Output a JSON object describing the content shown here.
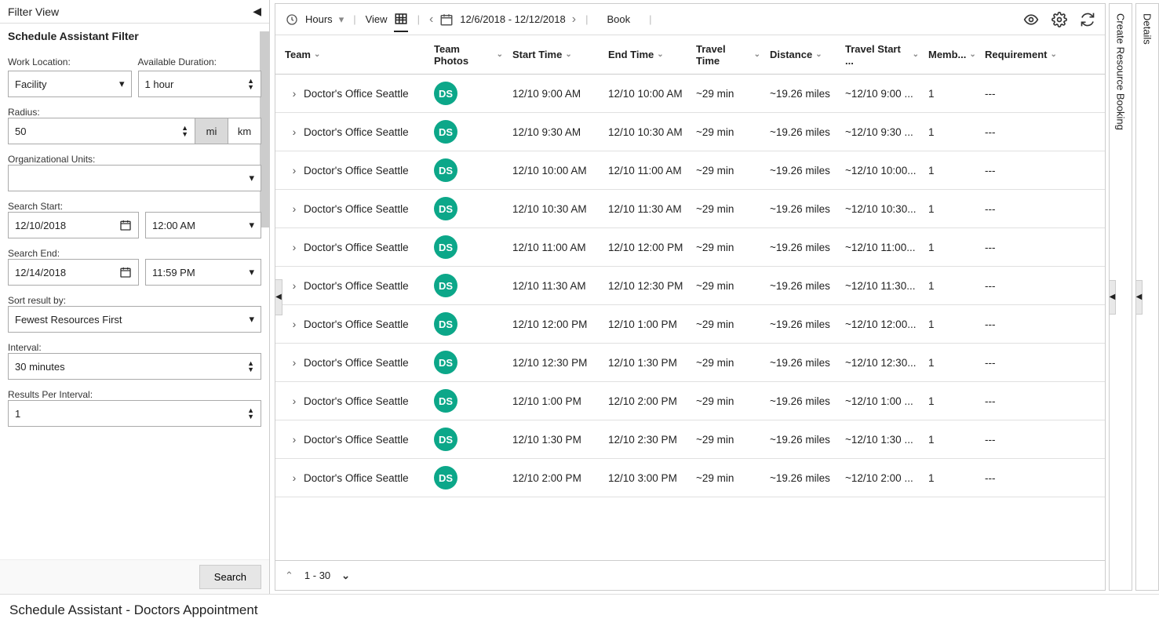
{
  "footer_title": "Schedule Assistant - Doctors Appointment",
  "left": {
    "header": "Filter View",
    "subheader": "Schedule Assistant Filter",
    "labels": {
      "work_location": "Work Location:",
      "available_duration": "Available Duration:",
      "radius": "Radius:",
      "org_units": "Organizational Units:",
      "search_start": "Search Start:",
      "search_end": "Search End:",
      "sort_result": "Sort result by:",
      "interval": "Interval:",
      "results_per_interval": "Results Per Interval:"
    },
    "values": {
      "work_location": "Facility",
      "available_duration": "1 hour",
      "radius": "50",
      "radius_unit_mi": "mi",
      "radius_unit_km": "km",
      "org_units": "",
      "search_start_date": "12/10/2018",
      "search_start_time": "12:00 AM",
      "search_end_date": "12/14/2018",
      "search_end_time": "11:59 PM",
      "sort_result": "Fewest Resources First",
      "interval": "30 minutes",
      "results_per_interval": "1"
    },
    "search_button": "Search"
  },
  "toolbar": {
    "hours_label": "Hours",
    "view_label": "View",
    "date_range": "12/6/2018 - 12/12/2018",
    "book_label": "Book"
  },
  "columns": {
    "team": "Team",
    "photos": "Team Photos",
    "start": "Start Time",
    "end": "End Time",
    "travel": "Travel Time",
    "distance": "Distance",
    "travel_start": "Travel Start ...",
    "members": "Memb...",
    "requirement": "Requirement"
  },
  "rows": [
    {
      "team": "Doctor's Office Seattle",
      "avatar": "DS",
      "start": "12/10 9:00 AM",
      "end": "12/10 10:00 AM",
      "travel": "~29 min",
      "distance": "~19.26 miles",
      "tstart": "~12/10 9:00 ...",
      "members": "1",
      "req": "---"
    },
    {
      "team": "Doctor's Office Seattle",
      "avatar": "DS",
      "start": "12/10 9:30 AM",
      "end": "12/10 10:30 AM",
      "travel": "~29 min",
      "distance": "~19.26 miles",
      "tstart": "~12/10 9:30 ...",
      "members": "1",
      "req": "---"
    },
    {
      "team": "Doctor's Office Seattle",
      "avatar": "DS",
      "start": "12/10 10:00 AM",
      "end": "12/10 11:00 AM",
      "travel": "~29 min",
      "distance": "~19.26 miles",
      "tstart": "~12/10 10:00...",
      "members": "1",
      "req": "---"
    },
    {
      "team": "Doctor's Office Seattle",
      "avatar": "DS",
      "start": "12/10 10:30 AM",
      "end": "12/10 11:30 AM",
      "travel": "~29 min",
      "distance": "~19.26 miles",
      "tstart": "~12/10 10:30...",
      "members": "1",
      "req": "---"
    },
    {
      "team": "Doctor's Office Seattle",
      "avatar": "DS",
      "start": "12/10 11:00 AM",
      "end": "12/10 12:00 PM",
      "travel": "~29 min",
      "distance": "~19.26 miles",
      "tstart": "~12/10 11:00...",
      "members": "1",
      "req": "---"
    },
    {
      "team": "Doctor's Office Seattle",
      "avatar": "DS",
      "start": "12/10 11:30 AM",
      "end": "12/10 12:30 PM",
      "travel": "~29 min",
      "distance": "~19.26 miles",
      "tstart": "~12/10 11:30...",
      "members": "1",
      "req": "---"
    },
    {
      "team": "Doctor's Office Seattle",
      "avatar": "DS",
      "start": "12/10 12:00 PM",
      "end": "12/10 1:00 PM",
      "travel": "~29 min",
      "distance": "~19.26 miles",
      "tstart": "~12/10 12:00...",
      "members": "1",
      "req": "---"
    },
    {
      "team": "Doctor's Office Seattle",
      "avatar": "DS",
      "start": "12/10 12:30 PM",
      "end": "12/10 1:30 PM",
      "travel": "~29 min",
      "distance": "~19.26 miles",
      "tstart": "~12/10 12:30...",
      "members": "1",
      "req": "---"
    },
    {
      "team": "Doctor's Office Seattle",
      "avatar": "DS",
      "start": "12/10 1:00 PM",
      "end": "12/10 2:00 PM",
      "travel": "~29 min",
      "distance": "~19.26 miles",
      "tstart": "~12/10 1:00 ...",
      "members": "1",
      "req": "---"
    },
    {
      "team": "Doctor's Office Seattle",
      "avatar": "DS",
      "start": "12/10 1:30 PM",
      "end": "12/10 2:30 PM",
      "travel": "~29 min",
      "distance": "~19.26 miles",
      "tstart": "~12/10 1:30 ...",
      "members": "1",
      "req": "---"
    },
    {
      "team": "Doctor's Office Seattle",
      "avatar": "DS",
      "start": "12/10 2:00 PM",
      "end": "12/10 3:00 PM",
      "travel": "~29 min",
      "distance": "~19.26 miles",
      "tstart": "~12/10 2:00 ...",
      "members": "1",
      "req": "---"
    }
  ],
  "pager": {
    "range": "1 - 30"
  },
  "right": {
    "booking_rail": "Create Resource Booking",
    "details_rail": "Details"
  }
}
